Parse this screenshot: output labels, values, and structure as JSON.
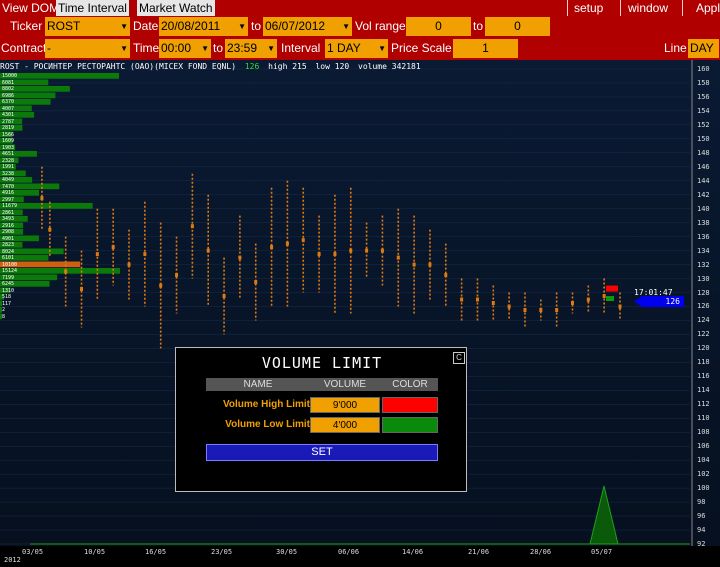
{
  "menu": {
    "tabs": [
      "View DOM",
      "Time Interval",
      "Market Watch"
    ],
    "right_items": [
      "setup",
      "window",
      "Appl"
    ]
  },
  "controls": {
    "ticker_label": "Ticker",
    "ticker_value": "ROST",
    "date_label": "Date",
    "date_from": "20/08/2011",
    "date_to_label": "to",
    "date_to": "06/07/2012",
    "vol_range_label": "Vol range",
    "vol_from": "0",
    "vol_to_label": "to",
    "vol_to": "0",
    "contract_label": "Contract",
    "contract_value": "-",
    "time_label": "Time",
    "time_from": "00:00",
    "time_to_label": "to",
    "time_to": "23:59",
    "interval_label": "Interval",
    "interval_value": "1 DAY",
    "price_scale_label": "Price Scale",
    "price_scale_value": "1",
    "chart_type_label": "Line",
    "chart_type_value": "DAY"
  },
  "chart_header": {
    "symbol_text": "ROST - РОСИНТЕР РЕСТОРАНТС (ОАО)(MICEX FOND EQNL)",
    "last": "126",
    "high_text": "high 215",
    "low_text": "low 120",
    "volume_text": "volume 342181"
  },
  "price_tag": {
    "time": "17:01:47",
    "price": "126"
  },
  "year_label": "2012",
  "chart_data": {
    "type": "bar",
    "y_ticks": [
      160,
      158,
      156,
      154,
      152,
      150,
      148,
      146,
      144,
      142,
      140,
      138,
      136,
      134,
      132,
      130,
      128,
      126,
      124,
      122,
      120,
      118,
      116,
      114,
      112,
      110,
      108,
      106,
      104,
      102,
      100,
      98,
      96,
      94,
      92
    ],
    "x_ticks": [
      "03/05",
      "10/05",
      "16/05",
      "23/05",
      "30/05",
      "06/06",
      "14/06",
      "21/06",
      "28/06",
      "05/07"
    ],
    "volume_profile_labels": [
      "15000",
      "6081",
      "8802",
      "6986",
      "6370",
      "4007",
      "4301",
      "2787",
      "2819",
      "1566",
      "1609",
      "1903",
      "4651",
      "2328",
      "1991",
      "3238",
      "4049",
      "7470",
      "4916",
      "2997",
      "11679",
      "2861",
      "3493",
      "2916",
      "2908",
      "4901",
      "2823",
      "8024",
      "6101",
      "10100",
      "15124",
      "7199",
      "6245",
      "1310",
      "518",
      "117",
      "2",
      "8"
    ],
    "volume_profile_values": [
      15000,
      6081,
      8802,
      6986,
      6370,
      4007,
      4301,
      2787,
      2819,
      1566,
      1609,
      1903,
      4651,
      2328,
      1991,
      3238,
      4049,
      7470,
      4916,
      2997,
      11679,
      2861,
      3493,
      2916,
      2908,
      4901,
      2823,
      8024,
      6101,
      10100,
      15124,
      7199,
      6245,
      1310,
      518,
      117,
      2,
      8
    ],
    "price_bars": [
      {
        "x": 0.5,
        "low": 137,
        "high": 146
      },
      {
        "x": 1,
        "low": 133,
        "high": 141
      },
      {
        "x": 2,
        "low": 126,
        "high": 136
      },
      {
        "x": 3,
        "low": 123,
        "high": 134
      },
      {
        "x": 4,
        "low": 127,
        "high": 140
      },
      {
        "x": 5,
        "low": 129,
        "high": 140
      },
      {
        "x": 6,
        "low": 127,
        "high": 137
      },
      {
        "x": 7,
        "low": 126,
        "high": 141
      },
      {
        "x": 8,
        "low": 120,
        "high": 138
      },
      {
        "x": 9,
        "low": 125,
        "high": 136
      },
      {
        "x": 10,
        "low": 130,
        "high": 145
      },
      {
        "x": 11,
        "low": 126,
        "high": 142
      },
      {
        "x": 12,
        "low": 122,
        "high": 133
      },
      {
        "x": 13,
        "low": 127,
        "high": 139
      },
      {
        "x": 14,
        "low": 124,
        "high": 135
      },
      {
        "x": 15,
        "low": 126,
        "high": 143
      },
      {
        "x": 16,
        "low": 126,
        "high": 144
      },
      {
        "x": 17,
        "low": 128,
        "high": 143
      },
      {
        "x": 18,
        "low": 128,
        "high": 139
      },
      {
        "x": 19,
        "low": 125,
        "high": 142
      },
      {
        "x": 20,
        "low": 125,
        "high": 143
      },
      {
        "x": 21,
        "low": 130,
        "high": 138
      },
      {
        "x": 22,
        "low": 129,
        "high": 139
      },
      {
        "x": 23,
        "low": 126,
        "high": 140
      },
      {
        "x": 24,
        "low": 125,
        "high": 139
      },
      {
        "x": 25,
        "low": 127,
        "high": 137
      },
      {
        "x": 26,
        "low": 126,
        "high": 135
      },
      {
        "x": 27,
        "low": 124,
        "high": 130
      },
      {
        "x": 28,
        "low": 124,
        "high": 130
      },
      {
        "x": 29,
        "low": 124,
        "high": 129
      },
      {
        "x": 30,
        "low": 124,
        "high": 128
      },
      {
        "x": 31,
        "low": 123,
        "high": 128
      },
      {
        "x": 32,
        "low": 124,
        "high": 127
      },
      {
        "x": 33,
        "low": 123,
        "high": 128
      },
      {
        "x": 34,
        "low": 125,
        "high": 128
      },
      {
        "x": 35,
        "low": 125,
        "high": 129
      },
      {
        "x": 36,
        "low": 125,
        "high": 130
      },
      {
        "x": 37,
        "low": 124,
        "high": 128
      }
    ],
    "volume": [
      0,
      0,
      0,
      0,
      0,
      0,
      0,
      0,
      0,
      0,
      0,
      0,
      0,
      0,
      0,
      0,
      0,
      0,
      0,
      0,
      0,
      0,
      0,
      0,
      0,
      0,
      0,
      0,
      0,
      0,
      0,
      0,
      0,
      0,
      0,
      1,
      8,
      1
    ],
    "ylim": [
      92,
      161
    ]
  },
  "dialog": {
    "title": "VOLUME LIMIT",
    "close_label": "C",
    "col_name": "NAME",
    "col_volume": "VOLUME",
    "col_color": "COLOR",
    "rows": [
      {
        "label": "Volume High Limit",
        "value": "9'000",
        "color": "#ff0000"
      },
      {
        "label": "Volume Low Limit",
        "value": "4'000",
        "color": "#0a8a0a"
      }
    ],
    "set_label": "SET"
  }
}
